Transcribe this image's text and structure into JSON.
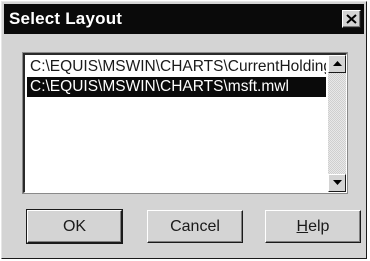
{
  "window": {
    "title": "Select Layout"
  },
  "layout_list": {
    "items": [
      {
        "label": "C:\\EQUIS\\MSWIN\\CHARTS\\CurrentHoldings",
        "selected": false
      },
      {
        "label": "C:\\EQUIS\\MSWIN\\CHARTS\\msft.mwl",
        "selected": true
      }
    ]
  },
  "buttons": {
    "ok_label": "OK",
    "cancel_label": "Cancel",
    "help_label_mnemonic": "H",
    "help_label_rest": "elp"
  },
  "icons": {
    "close": "close-icon",
    "scroll_up": "arrow-up-icon",
    "scroll_down": "arrow-down-icon"
  }
}
